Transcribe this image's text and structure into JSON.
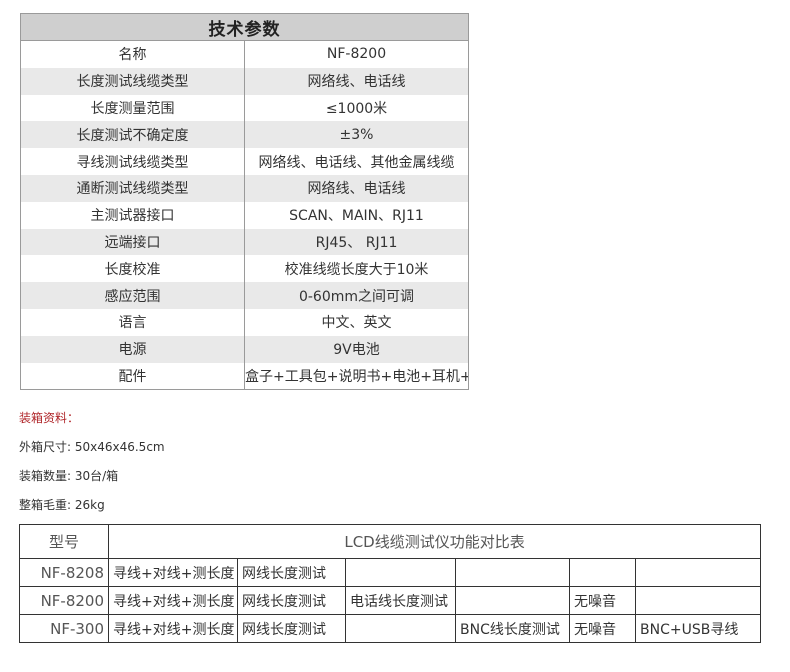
{
  "spec": {
    "title": "技术参数",
    "rows": [
      {
        "name": "名称",
        "value": "NF-8200"
      },
      {
        "name": "长度测试线缆类型",
        "value": "网络线、电话线"
      },
      {
        "name": "长度测量范围",
        "value": "≤1000米"
      },
      {
        "name": "长度测试不确定度",
        "value": "±3%"
      },
      {
        "name": "寻线测试线缆类型",
        "value": "网络线、电话线、其他金属线缆"
      },
      {
        "name": "通断测试线缆类型",
        "value": "网络线、电话线"
      },
      {
        "name": "主测试器接口",
        "value": "SCAN、MAIN、RJ11"
      },
      {
        "name": "远端接口",
        "value": "RJ45、 RJ11"
      },
      {
        "name": "长度校准",
        "value": "校准线缆长度大于10米"
      },
      {
        "name": "感应范围",
        "value": "0-60mm之间可调"
      },
      {
        "name": "语言",
        "value": "中文、英文"
      },
      {
        "name": "电源",
        "value": "9V电池"
      },
      {
        "name": "配件",
        "value": "盒子+工具包+说明书+电池+耳机+鳄鱼夹"
      }
    ]
  },
  "packing": {
    "heading": "装箱资料：",
    "carton_size": "外箱尺寸: 50x46x46.5cm",
    "quantity": "装箱数量: 30台/箱",
    "gross_weight": "整箱毛重: 26kg"
  },
  "comparison": {
    "model_header": "型号",
    "title": "LCD线缆测试仪功能对比表",
    "rows": [
      {
        "model": "NF-8208",
        "cells": [
          "寻线+对线+测长度",
          "网线长度测试",
          "",
          "",
          "",
          ""
        ]
      },
      {
        "model": "NF-8200",
        "cells": [
          "寻线+对线+测长度",
          "网线长度测试",
          "电话线长度测试",
          "",
          "无噪音",
          ""
        ]
      },
      {
        "model": "NF-300",
        "cells": [
          "寻线+对线+测长度",
          "网线长度测试",
          "",
          "BNC线长度测试",
          "无噪音",
          "BNC+USB寻线"
        ]
      }
    ]
  }
}
